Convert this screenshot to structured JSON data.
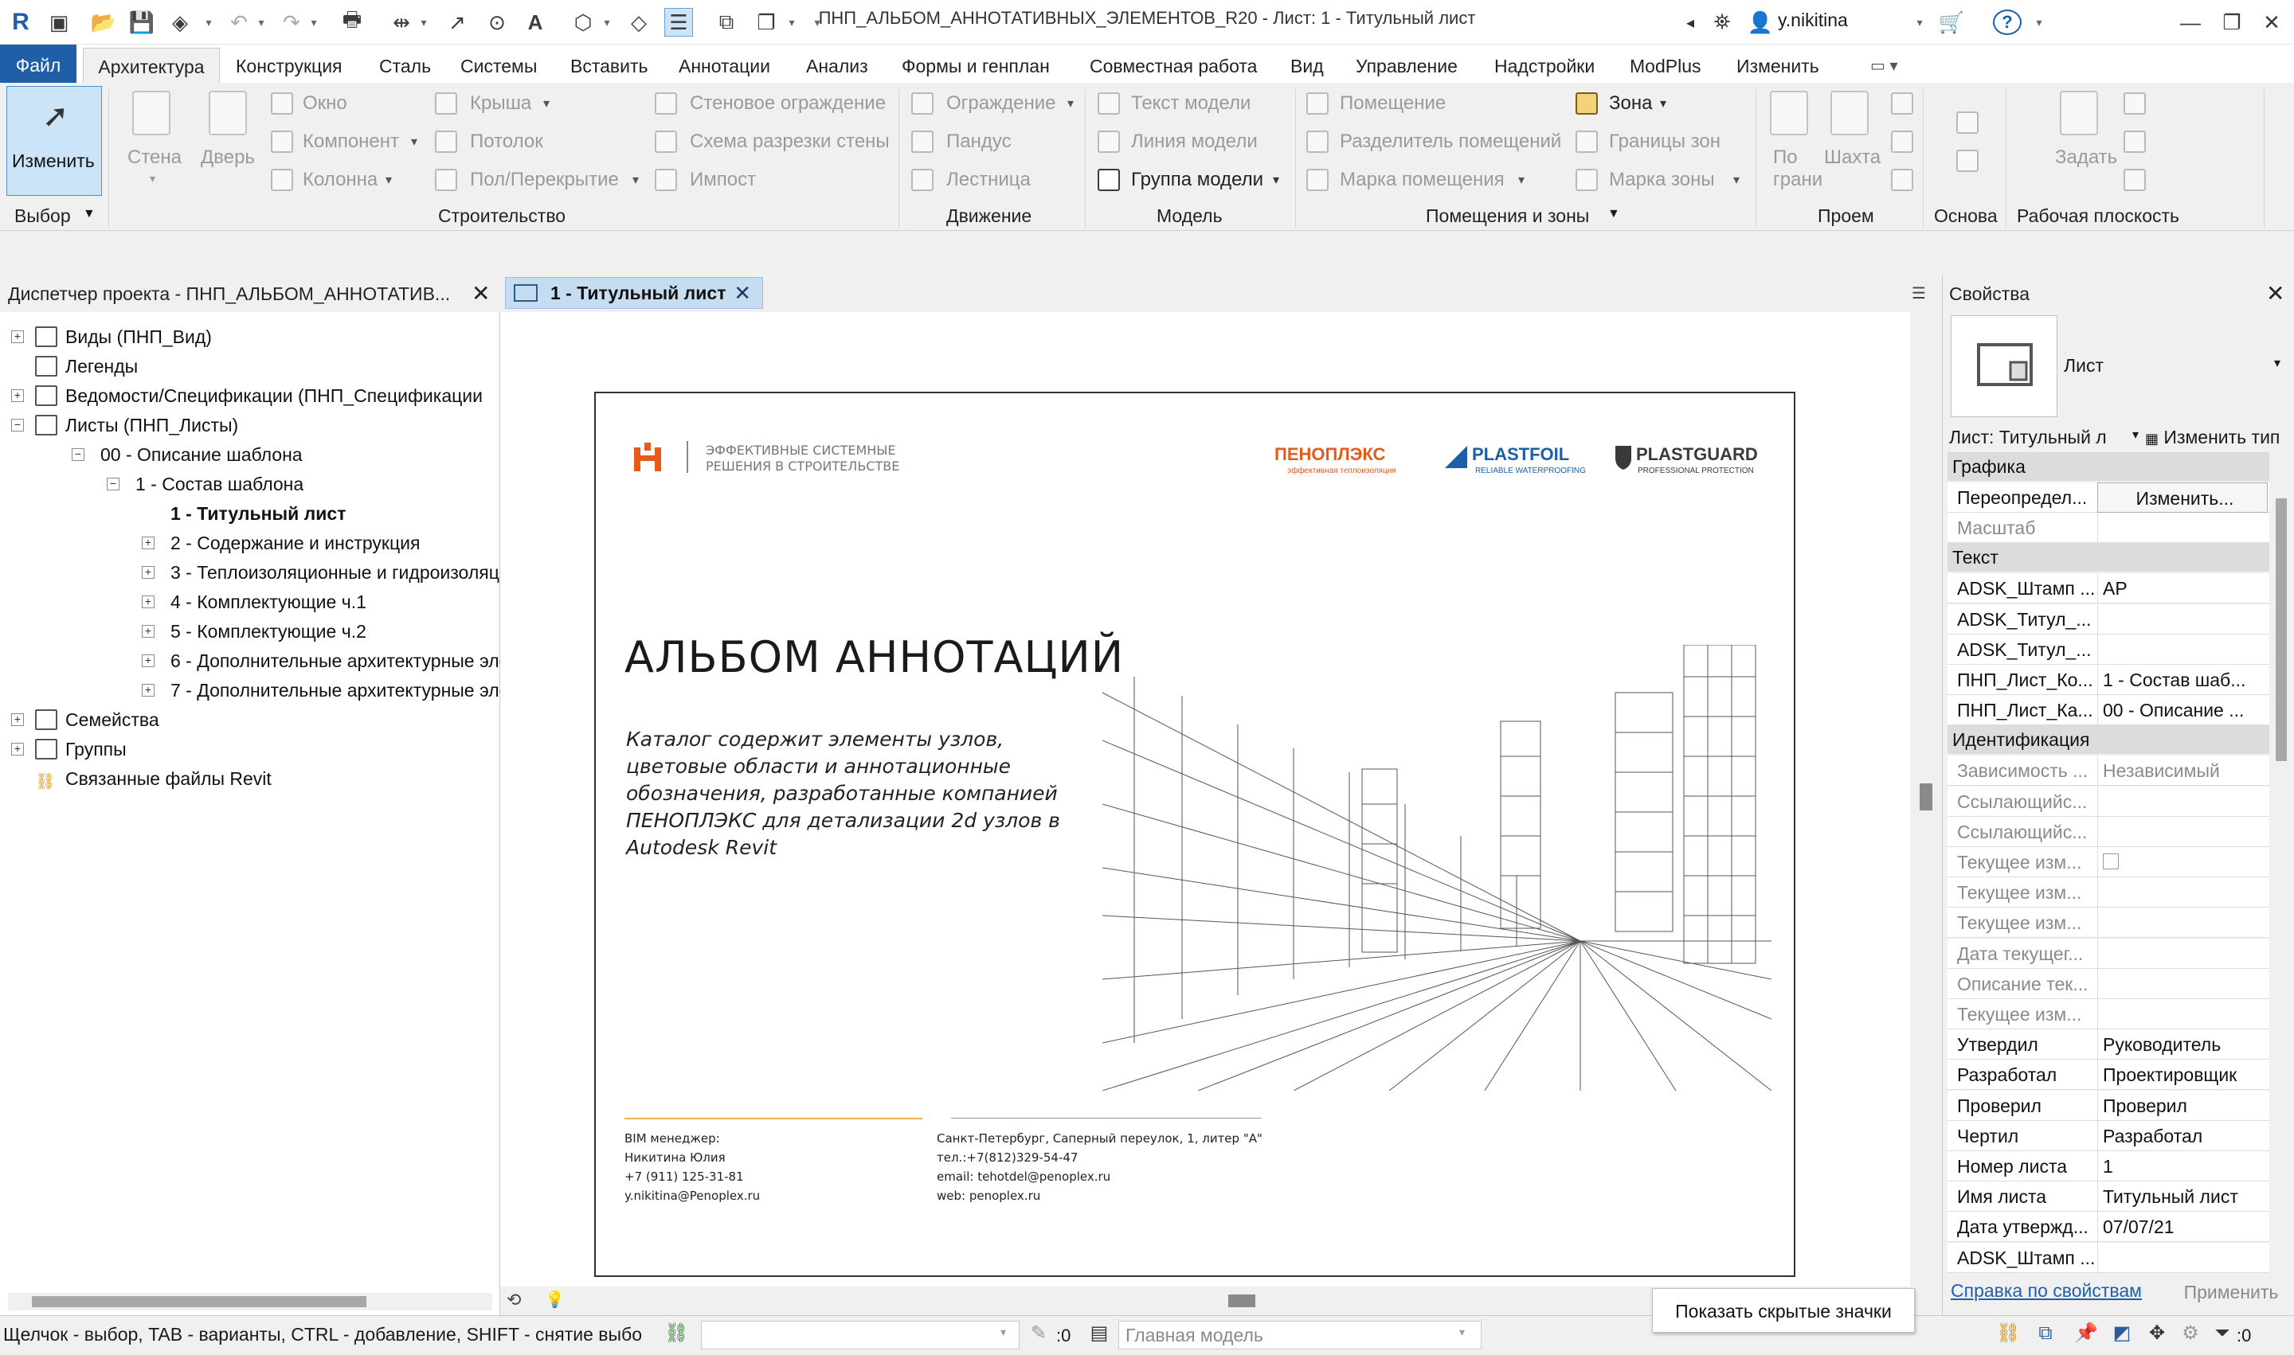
{
  "titlebar": {
    "window_title": "ПНП_АЛЬБОМ_АННОТАТИВНЫХ_ЭЛЕМЕНТОВ_R20 - Лист: 1 - Титульный лист",
    "user": "y.nikitina",
    "help": "?"
  },
  "menu": {
    "file": "Файл",
    "tabs": [
      "Архитектура",
      "Конструкция",
      "Сталь",
      "Системы",
      "Вставить",
      "Аннотации",
      "Анализ",
      "Формы и генплан",
      "Совместная работа",
      "Вид",
      "Управление",
      "Надстройки",
      "ModPlus",
      "Изменить"
    ]
  },
  "ribbon": {
    "modify": "Изменить",
    "wall": "Стена",
    "door": "Дверь",
    "window": "Окно",
    "component": "Компонент",
    "column": "Колонна",
    "roof": "Крыша",
    "ceiling": "Потолок",
    "floor": "Пол/Перекрытие",
    "curtain_wall": "Стеновое ограждение",
    "curtain_grid": "Схема разрезки стены",
    "mullion": "Импост",
    "railing": "Ограждение",
    "ramp": "Пандус",
    "stair": "Лестница",
    "model_text": "Текст модели",
    "model_line": "Линия  модели",
    "model_group": "Группа модели",
    "room": "Помещение",
    "room_separator": "Разделитель помещений",
    "room_tag": "Марка помещения",
    "area": "Зона",
    "area_boundary": "Границы  зон",
    "area_tag": "Марка  зоны",
    "by_face": "По грани",
    "shaft": "Шахта",
    "set": "Задать",
    "panels": {
      "select": "Выбор",
      "build": "Строительство",
      "circulation": "Движение",
      "model": "Модель",
      "room_area": "Помещения и зоны",
      "opening": "Проем",
      "datum": "Основа",
      "work_plane": "Рабочая плоскость"
    }
  },
  "browser": {
    "header": "Диспетчер проекта - ПНП_АЛЬБОМ_АННОТАТИВ...",
    "items": [
      {
        "label": "Виды (ПНП_Вид)",
        "level": 0,
        "toggle": "+"
      },
      {
        "label": "Легенды",
        "level": 0,
        "toggle": ""
      },
      {
        "label": "Ведомости/Спецификации (ПНП_Спецификации",
        "level": 0,
        "toggle": "+"
      },
      {
        "label": "Листы (ПНП_Листы)",
        "level": 0,
        "toggle": "−"
      },
      {
        "label": "00 - Описание шаблона",
        "level": 1,
        "toggle": "−"
      },
      {
        "label": "1 - Состав шаблона",
        "level": 2,
        "toggle": "−"
      },
      {
        "label": "1 - Титульный лист",
        "level": 3,
        "toggle": ""
      },
      {
        "label": "2 - Содержание и инструкция",
        "level": 3,
        "toggle": "+"
      },
      {
        "label": "3 - Теплоизоляционные и гидроизоляци",
        "level": 3,
        "toggle": "+"
      },
      {
        "label": "4 - Комплектующие ч.1",
        "level": 3,
        "toggle": "+"
      },
      {
        "label": "5 - Комплектующие ч.2",
        "level": 3,
        "toggle": "+"
      },
      {
        "label": "6 - Дополнительные архитектурные элем",
        "level": 3,
        "toggle": "+"
      },
      {
        "label": "7 - Дополнительные архитектурные элем",
        "level": 3,
        "toggle": "+"
      },
      {
        "label": "Семейства",
        "level": 0,
        "toggle": "+"
      },
      {
        "label": "Группы",
        "level": 0,
        "toggle": "+"
      },
      {
        "label": "Связанные файлы Revit",
        "level": 0,
        "toggle": ""
      }
    ]
  },
  "view": {
    "tab_label": "1 - Титульный лист"
  },
  "sheet": {
    "tagline": "ЭФФЕКТИВНЫЕ СИСТЕМНЫЕ\nРЕШЕНИЯ В СТРОИТЕЛЬСТВЕ",
    "brand1": "ПЕНОПЛЭКС",
    "brand1_sub": "эффективная теплоизоляция",
    "brand2": "PLASTFOIL",
    "brand2_sub": "RELIABLE WATERPROOFING",
    "brand3": "PLASTGUARD",
    "brand3_sub": "PROFESSIONAL PROTECTION",
    "title": "АЛЬБОМ АННОТАЦИЙ",
    "description": "Каталог содержит элементы узлов, цветовые области и аннотационные обозначения, разработанные компанией ПЕНОПЛЭКС для детализации 2d узлов в Autodesk Revit",
    "contact_left": [
      "BIM менеджер:",
      "Никитина Юлия",
      " +7 (911) 125-31-81",
      "y.nikitina@Penoplex.ru"
    ],
    "contact_right": [
      "Санкт-Петербург, Саперный переулок, 1, литер \"А\"",
      "тел.:+7(812)329-54-47",
      "email: tehotdel@penoplex.ru",
      "web: penoplex.ru"
    ],
    "accent_color": "#e85a1a"
  },
  "properties": {
    "header": "Свойства",
    "type_name": "Лист",
    "instance_selector": "Лист: Титульный л",
    "edit_type": "Изменить тип",
    "rows": [
      {
        "group": "Графика"
      },
      {
        "k": "Переопредел...",
        "v": "Изменить...",
        "button": true
      },
      {
        "k": "Масштаб",
        "v": "",
        "dim": true
      },
      {
        "group": "Текст"
      },
      {
        "k": "ADSK_Штамп ...",
        "v": "АР"
      },
      {
        "k": "ADSK_Титул_...",
        "v": ""
      },
      {
        "k": "ADSK_Титул_...",
        "v": ""
      },
      {
        "k": "ПНП_Лист_Ко...",
        "v": "1 - Состав шаб..."
      },
      {
        "k": "ПНП_Лист_Ка...",
        "v": "00 - Описание ..."
      },
      {
        "group": "Идентификация"
      },
      {
        "k": "Зависимость ...",
        "v": "Независимый",
        "dim": true
      },
      {
        "k": "Ссылающийс...",
        "v": "",
        "dim": true
      },
      {
        "k": "Ссылающийс...",
        "v": "",
        "dim": true
      },
      {
        "k": "Текущее изм...",
        "v": "",
        "dim": true,
        "checkbox": true
      },
      {
        "k": "Текущее изм...",
        "v": "",
        "dim": true
      },
      {
        "k": "Текущее изм...",
        "v": "",
        "dim": true
      },
      {
        "k": "Дата текущег...",
        "v": "",
        "dim": true
      },
      {
        "k": "Описание тек...",
        "v": "",
        "dim": true
      },
      {
        "k": "Текущее изм...",
        "v": "",
        "dim": true
      },
      {
        "k": "Утвердил",
        "v": "Руководитель"
      },
      {
        "k": "Разработал",
        "v": "Проектировщик"
      },
      {
        "k": "Проверил",
        "v": "Проверил"
      },
      {
        "k": "Чертил",
        "v": "Разработал"
      },
      {
        "k": "Номер листа",
        "v": "1"
      },
      {
        "k": "Имя листа",
        "v": "Титульный лист"
      },
      {
        "k": "Дата утвержд...",
        "v": "07/07/21"
      },
      {
        "k": "ADSK_Штамп ...",
        "v": ""
      }
    ],
    "help_link": "Справка по свойствам",
    "apply": "Применить"
  },
  "status": {
    "hint": "Щелчок - выбор, TAB - варианты, CTRL - добавление, SHIFT - снятие выбо",
    "zero1": ":0",
    "main_model": "Главная модель",
    "zero2": ":0"
  },
  "tooltip": "Показать скрытые значки"
}
